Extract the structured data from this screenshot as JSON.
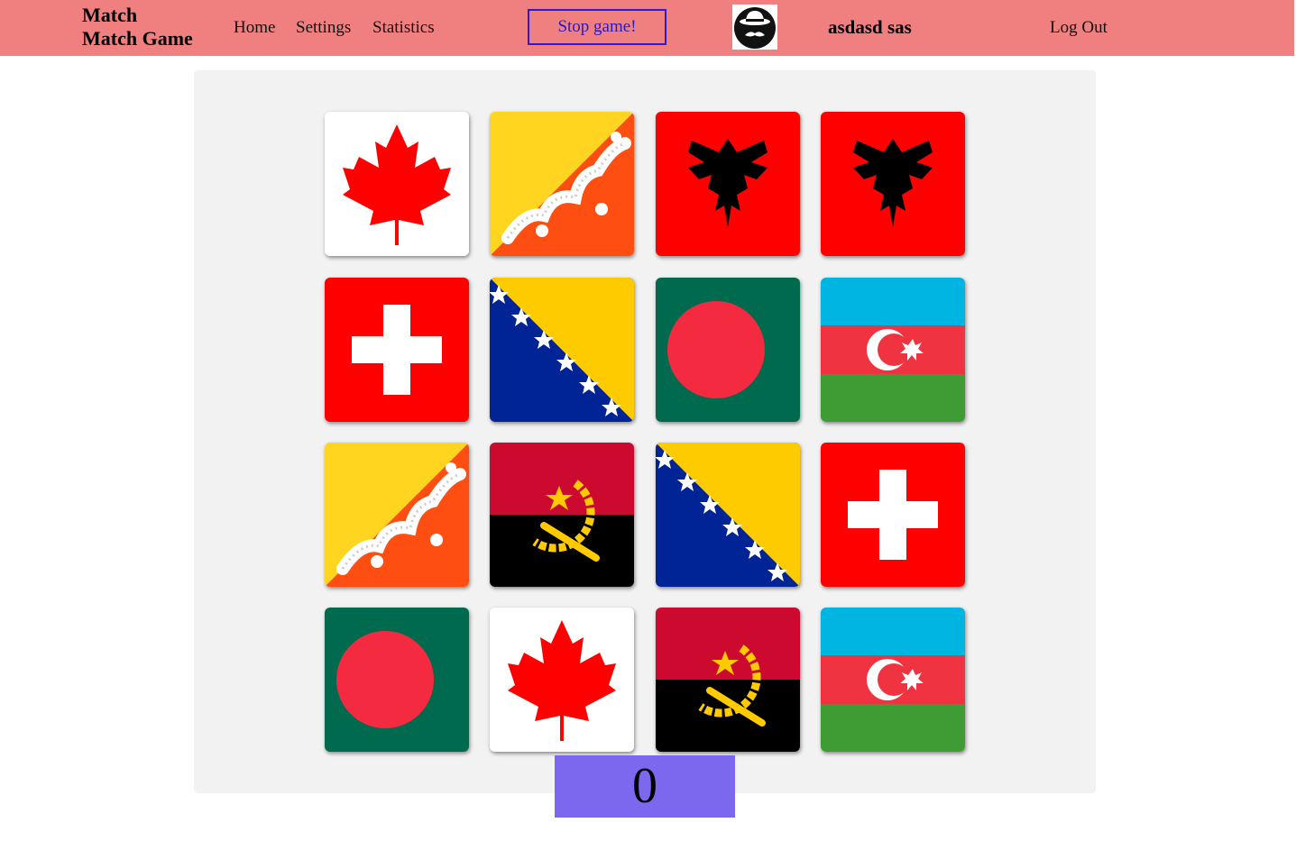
{
  "header": {
    "logo_line1": "Match",
    "logo_line2": "Match Game",
    "nav": {
      "home": "Home",
      "settings": "Settings",
      "statistics": "Statistics"
    },
    "stop_button": "Stop game!",
    "username": "asdasd sas",
    "logout": "Log Out",
    "background_color": "#f08080",
    "button_border_color": "#2c1bd6"
  },
  "board": {
    "background_color": "#f2f2f2",
    "cards": [
      [
        "canada-flag",
        "bhutan-flag",
        "albania-flag",
        "albania-flag"
      ],
      [
        "switzerland-flag",
        "bosnia-flag",
        "bangladesh-flag",
        "azerbaijan-flag"
      ],
      [
        "bhutan-flag",
        "angola-flag",
        "bosnia-flag",
        "switzerland-flag"
      ],
      [
        "bangladesh-flag",
        "canada-flag",
        "angola-flag",
        "azerbaijan-flag"
      ]
    ]
  },
  "score": {
    "value": "0",
    "background_color": "#7b68ee"
  }
}
